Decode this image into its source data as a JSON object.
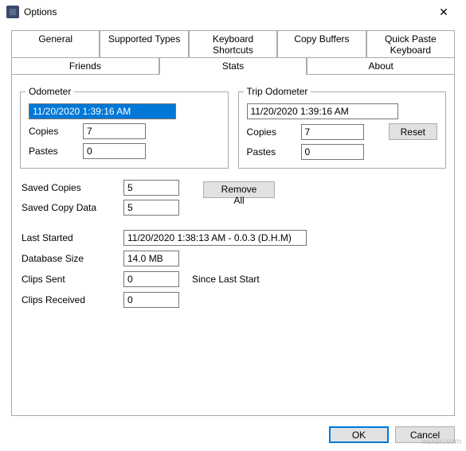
{
  "window": {
    "title": "Options",
    "close_glyph": "✕"
  },
  "tabs": {
    "row1": [
      "General",
      "Supported Types",
      "Keyboard Shortcuts",
      "Copy Buffers",
      "Quick Paste Keyboard"
    ],
    "row2": [
      "Friends",
      "Stats",
      "About"
    ],
    "active": "Stats"
  },
  "odometer": {
    "legend": "Odometer",
    "date": "11/20/2020 1:39:16 AM",
    "copies_label": "Copies",
    "copies": "7",
    "pastes_label": "Pastes",
    "pastes": "0"
  },
  "trip": {
    "legend": "Trip Odometer",
    "date": "11/20/2020 1:39:16 AM",
    "copies_label": "Copies",
    "copies": "7",
    "pastes_label": "Pastes",
    "pastes": "0",
    "reset": "Reset"
  },
  "saved": {
    "copies_label": "Saved Copies",
    "copies": "5",
    "data_label": "Saved Copy Data",
    "data": "5",
    "remove_all": "Remove All"
  },
  "info": {
    "last_started_label": "Last Started",
    "last_started": "11/20/2020 1:38:13 AM  -  0.0.3 (D.H.M)",
    "db_size_label": "Database Size",
    "db_size": "14.0 MB",
    "clips_sent_label": "Clips Sent",
    "clips_sent": "0",
    "clips_recv_label": "Clips Received",
    "clips_recv": "0",
    "since": "Since Last Start"
  },
  "footer": {
    "ok": "OK",
    "cancel": "Cancel"
  },
  "watermark": "wsxdn.com"
}
